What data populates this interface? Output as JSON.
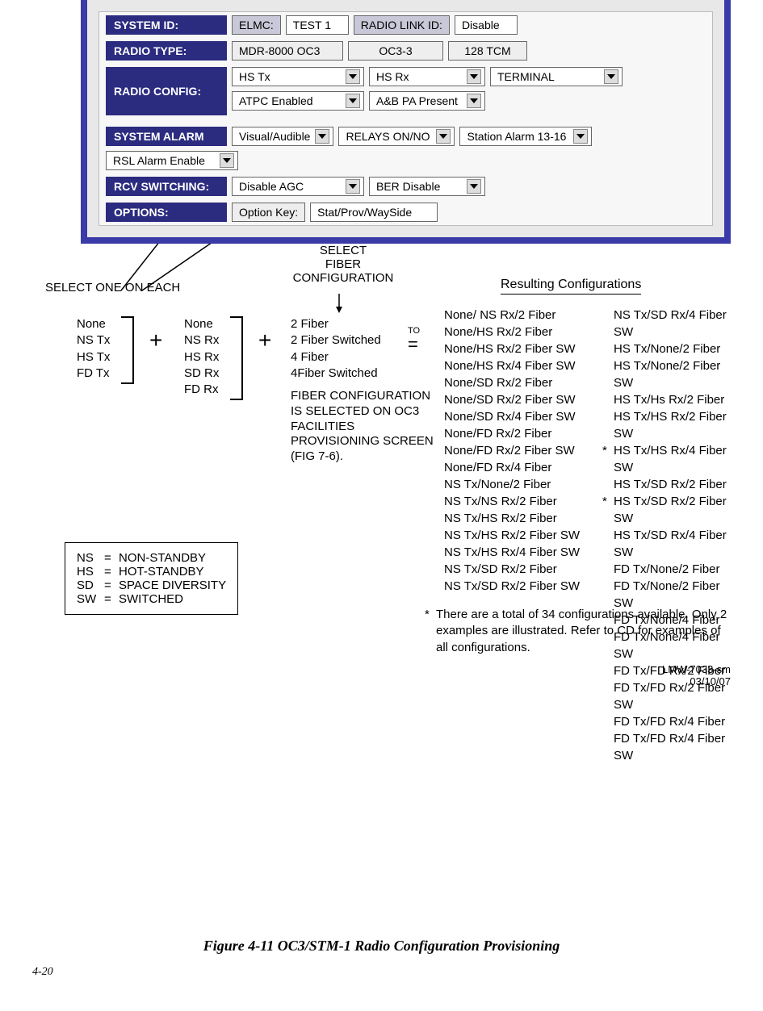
{
  "panel": {
    "system_id_lbl": "SYSTEM ID:",
    "elmc_lbl": "ELMC:",
    "elmc_val": "TEST 1",
    "radio_link_id_lbl": "RADIO LINK ID:",
    "radio_link_id_val": "Disable",
    "radio_type_lbl": "RADIO TYPE:",
    "radio_type_a": "MDR-8000 OC3",
    "radio_type_b": "OC3-3",
    "radio_type_c": "128 TCM",
    "radio_config_lbl": "RADIO CONFIG:",
    "hs_tx": "HS Tx",
    "hs_rx": "HS Rx",
    "terminal": "TERMINAL",
    "atpc": "ATPC Enabled",
    "ab_pa": "A&B PA Present",
    "system_alarm_lbl": "SYSTEM ALARM",
    "visual_audible": "Visual/Audible",
    "relays": "RELAYS ON/NO",
    "station_alarm": "Station Alarm 13-16",
    "rsl_alarm": "RSL Alarm Enable",
    "rcv_switch_lbl": "RCV SWITCHING:",
    "disable_agc": "Disable AGC",
    "ber_disable": "BER Disable",
    "options_lbl": "OPTIONS:",
    "option_key_lbl": "Option Key:",
    "option_key_val": "Stat/Prov/WaySide"
  },
  "diagram": {
    "select_one": "SELECT ONE ON EACH",
    "select_fiber_l1": "SELECT",
    "select_fiber_l2": "FIBER",
    "select_fiber_l3": "CONFIGURATION",
    "tx_list": [
      "None",
      "NS Tx",
      "HS Tx",
      "FD Tx"
    ],
    "rx_list": [
      "None",
      "NS Rx",
      "HS Rx",
      "SD Rx",
      "FD Rx"
    ],
    "fiber_list": [
      "2 Fiber",
      "2 Fiber Switched",
      "4 Fiber",
      "4Fiber Switched"
    ],
    "plus": "+",
    "to": "TO",
    "eq": "=",
    "fiber_note": "FIBER CONFIGURATION IS SELECTED ON OC3 FACILITIES PROVISIONING SCREEN (FIG 7-6).",
    "results_hdr": "Resulting Configurations",
    "results_left": [
      "None/ NS Rx/2 Fiber",
      "None/HS Rx/2 Fiber",
      "None/HS Rx/2 Fiber SW",
      "None/HS Rx/4 Fiber SW",
      "None/SD Rx/2 Fiber",
      "None/SD Rx/2 Fiber SW",
      "None/SD Rx/4 Fiber SW",
      "None/FD Rx/2 Fiber",
      "None/FD Rx/2 Fiber SW",
      "None/FD Rx/4 Fiber",
      "NS Tx/None/2 Fiber",
      "NS Tx/NS Rx/2 Fiber",
      "NS Tx/HS Rx/2 Fiber",
      "NS Tx/HS Rx/2 Fiber SW",
      "NS Tx/HS Rx/4 Fiber SW",
      "NS Tx/SD Rx/2 Fiber",
      "NS Tx/SD Rx/2 Fiber SW"
    ],
    "results_right": [
      "NS Tx/SD Rx/4 Fiber SW",
      "HS Tx/None/2 Fiber",
      "HS Tx/None/2 Fiber SW",
      "HS Tx/Hs Rx/2 Fiber",
      "HS Tx/HS Rx/2 Fiber SW",
      "HS Tx/HS Rx/4 Fiber SW",
      "HS Tx/SD Rx/2 Fiber",
      "HS Tx/SD Rx/2 Fiber SW",
      "HS Tx/SD Rx/4 Fiber SW",
      "FD Tx/None/2 Fiber",
      "FD Tx/None/2 Fiber SW",
      "FD Tx/None/4 Fiber",
      "FD Tx/None/4 Fiber SW",
      "FD Tx/FD Rx/2 Fiber",
      "FD Tx/FD Rx/2 Fiber SW",
      "FD Tx/FD Rx/4 Fiber",
      "FD Tx/FD Rx/4 Fiber SW"
    ],
    "star_right_idx": [
      5,
      7
    ],
    "legend": [
      {
        "a": "NS",
        "b": "=",
        "c": "NON-STANDBY"
      },
      {
        "a": "HS",
        "b": "=",
        "c": "HOT-STANDBY"
      },
      {
        "a": "SD",
        "b": "=",
        "c": "SPACE DIVERSITY"
      },
      {
        "a": "SW",
        "b": "=",
        "c": "SWITCHED"
      }
    ],
    "footnote_star": "*",
    "footnote": "There  are a total of 34 configurations available. Only 2 examples are illustrated. Refer to CD for examples of all configurations.",
    "docid_1": "LMW-7033-sm",
    "docid_2": "03/10/07"
  },
  "caption": "Figure 4-11  OC3/STM-1 Radio Configuration Provisioning",
  "page_num": "4-20"
}
